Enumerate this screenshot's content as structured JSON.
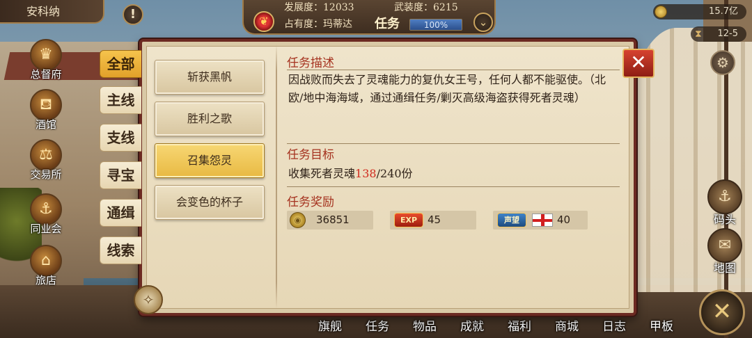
{
  "hud": {
    "city_name": "安科纳",
    "alert_icon": "!",
    "development": "发展度：12033",
    "military": "武装度：6215",
    "occupancy": "占有度：玛蒂达",
    "task_label": "任务",
    "progress_text": "100%",
    "progress_value": 1.0,
    "gold": "15.7亿",
    "date": "12-5"
  },
  "city_menu": [
    {
      "label": "总督府",
      "icon": "crown-icon"
    },
    {
      "label": "酒馆",
      "icon": "tavern-icon"
    },
    {
      "label": "交易所",
      "icon": "scales-icon"
    },
    {
      "label": "同业会",
      "icon": "guild-icon"
    },
    {
      "label": "旅店",
      "icon": "inn-icon"
    }
  ],
  "side_buttons": [
    {
      "label": "码头",
      "icon": "dock-icon"
    },
    {
      "label": "地图",
      "icon": "map-icon"
    }
  ],
  "bottom_bar": [
    "旗舰",
    "任务",
    "物品",
    "成就",
    "福利",
    "商城",
    "日志",
    "甲板"
  ],
  "categories": [
    {
      "label": "全部",
      "active": true
    },
    {
      "label": "主线",
      "active": false
    },
    {
      "label": "支线",
      "active": false
    },
    {
      "label": "寻宝",
      "active": false
    },
    {
      "label": "通缉",
      "active": false
    },
    {
      "label": "线索",
      "active": false
    }
  ],
  "quests": [
    {
      "label": "斩获黑帆",
      "active": false
    },
    {
      "label": "胜利之歌",
      "active": false
    },
    {
      "label": "召集怨灵",
      "active": true
    },
    {
      "label": "会变色的杯子",
      "active": false
    }
  ],
  "detail": {
    "desc_title": "任务描述",
    "desc_text": "因战败而失去了灵魂能力的复仇女王号，任何人都不能驱使。（北欧/地中海海域，通过通缉任务/剿灭高级海盗获得死者灵魂）",
    "goal_title": "任务目标",
    "goal_prefix": "收集死者灵魂",
    "goal_current": "138",
    "goal_suffix": "/240份",
    "reward_title": "任务奖励",
    "rewards": {
      "gold": "36851",
      "exp_badge": "EXP",
      "exp": "45",
      "rep_badge": "声望",
      "rep": "40"
    }
  },
  "colors": {
    "accent_gold": "#e8b942",
    "title_red": "#a5321f",
    "goal_red": "#d02a1e",
    "panel_border": "#6c2a22"
  }
}
